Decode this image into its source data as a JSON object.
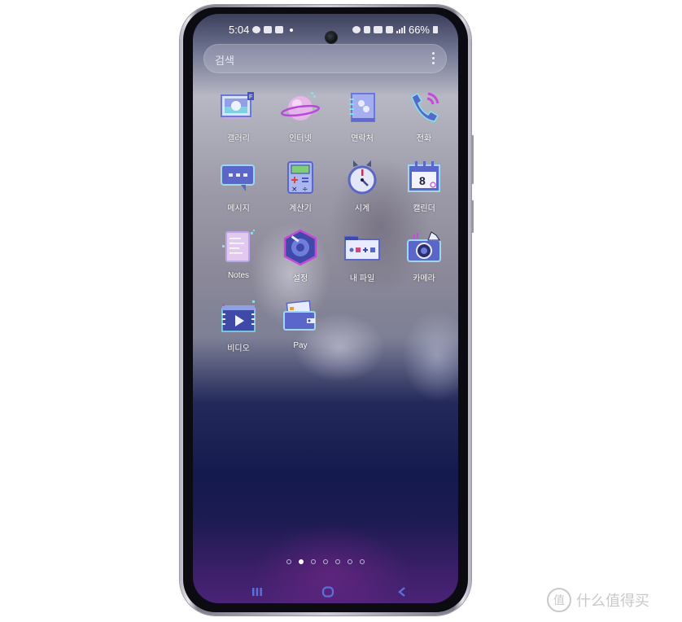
{
  "status_bar": {
    "time": "5:04",
    "left_icons": [
      "chat-notification-icon",
      "gallery-notification-icon",
      "photo-notification-icon"
    ],
    "right_icons": [
      "alarm-icon",
      "mute-icon",
      "hd-voice-icon",
      "5g-icon",
      "signal-icon"
    ],
    "battery_text": "66%"
  },
  "search": {
    "placeholder": "검색",
    "menu_icon": "more-vertical-icon"
  },
  "apps": [
    {
      "label": "갤러리",
      "icon": "gallery-icon"
    },
    {
      "label": "인터넷",
      "icon": "internet-planet-icon"
    },
    {
      "label": "연락처",
      "icon": "contacts-book-icon"
    },
    {
      "label": "전화",
      "icon": "phone-icon"
    },
    {
      "label": "메시지",
      "icon": "message-bubble-icon"
    },
    {
      "label": "계산기",
      "icon": "calculator-icon"
    },
    {
      "label": "시계",
      "icon": "clock-icon"
    },
    {
      "label": "캘린더",
      "icon": "calendar-icon",
      "badge": "8"
    },
    {
      "label": "Notes",
      "icon": "notes-icon"
    },
    {
      "label": "설정",
      "icon": "settings-gear-icon"
    },
    {
      "label": "내 파일",
      "icon": "my-files-folder-icon"
    },
    {
      "label": "카메라",
      "icon": "camera-icon"
    },
    {
      "label": "비디오",
      "icon": "video-icon"
    },
    {
      "label": "Pay",
      "icon": "wallet-icon"
    }
  ],
  "page_indicator": {
    "total": 7,
    "active_index": 1
  },
  "navigation": {
    "recents": "recents-icon",
    "home": "home-icon",
    "back": "back-icon"
  },
  "colors": {
    "nav_icon": "#5b6fd6",
    "icon_primary": "#5a66c9",
    "icon_accent": "#c44ad8",
    "icon_light": "#d9dcf5"
  },
  "watermark": {
    "badge": "值",
    "text": "什么值得买"
  }
}
